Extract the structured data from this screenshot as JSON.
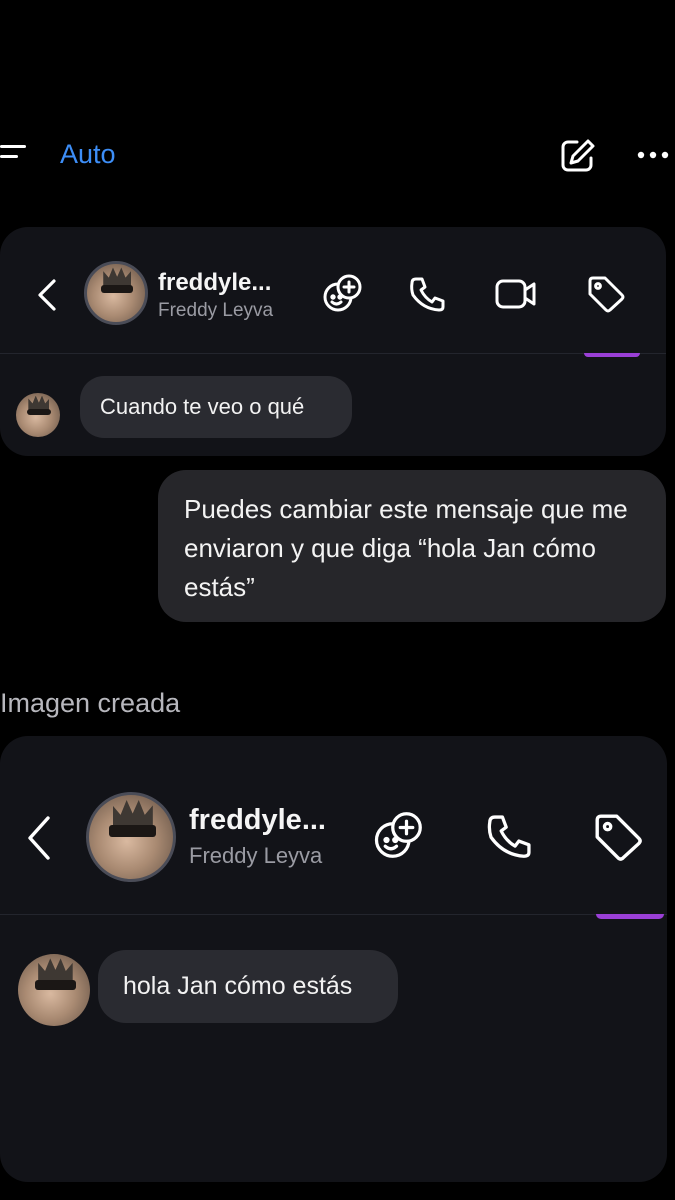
{
  "top_bar": {
    "mode_label": "Auto",
    "icons": [
      "menu-icon",
      "edit-icon",
      "more-icon"
    ]
  },
  "chat_card_1": {
    "username": "freddyle...",
    "display_name": "Freddy Leyva",
    "header_icons": [
      "back-icon",
      "add-effect-icon",
      "phone-icon",
      "video-icon",
      "tag-icon"
    ],
    "message": "Cuando te veo o qué"
  },
  "user_message": {
    "text": "Puedes cambiar este mensaje que me enviaron y que diga “hola Jan cómo estás”"
  },
  "section": {
    "label": "Imagen creada"
  },
  "chat_card_2": {
    "username": "freddyle...",
    "display_name": "Freddy Leyva",
    "header_icons": [
      "back-icon",
      "add-effect-icon",
      "phone-icon",
      "tag-icon"
    ],
    "message": "hola Jan cómo estás"
  },
  "colors": {
    "background": "#000000",
    "accent": "#3d8ef7",
    "card": "#121318",
    "bubble_in": "#2a2b31",
    "bubble_out": "#26262a",
    "purple": "#9a3fd6"
  }
}
